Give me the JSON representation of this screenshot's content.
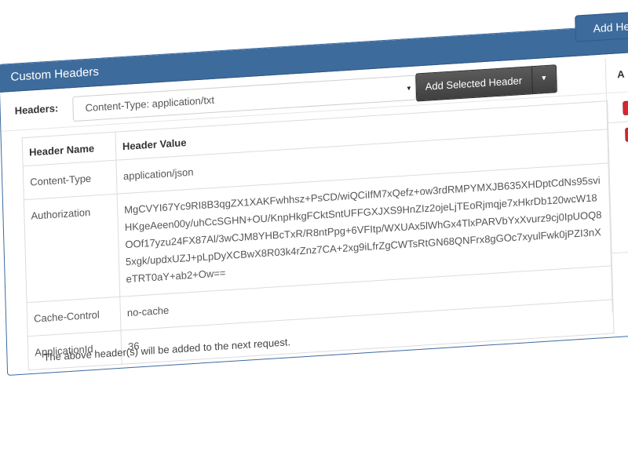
{
  "panel": {
    "title": "Custom Headers",
    "add_header_button": "Add Header"
  },
  "selector": {
    "label": "Headers:",
    "selected_value": "Content-Type: application/txt",
    "add_selected_button": "Add Selected Header"
  },
  "table": {
    "columns": [
      "Header Name",
      "Header Value"
    ],
    "actions_column_label": "A",
    "rows": [
      {
        "name": "Content-Type",
        "value": "application/json"
      },
      {
        "name": "Authorization",
        "value": "MgCVYI67Yc9RI8B3qgZX1XAKFwhhsz+PsCD/wiQCiIfM7xQefz+ow3rdRMPYMXJB635XHDptCdNs95sviHKgeAeen00y/uhCcSGHN+OU/KnpHkgFCktSntUFFGXJXS9HnZIz2ojeLjTEoRjmqje7xHkrDb120wcW18OOf17yzu24FX87Al/3wCJM8YHBcTxR/R8ntPpg+6VFItp/WXUAx5lWhGx4TlxPARVbYxXvurz9cj0IpUOQ85xgk/updxUZJ+pLpDyXCBwX8R03k4rZnz7CA+2xg9iLfrZgCWTsRtGN68QNFrx8gGOc7xyulFwk0jPZI3nXeTRT0aY+ab2+Ow=="
      },
      {
        "name": "Cache-Control",
        "value": "no-cache"
      },
      {
        "name": "ApplicationId",
        "value": "36"
      }
    ]
  },
  "footer_note": "The above header(s) will be added to the next request.",
  "colors": {
    "panel_header_bg": "#3d6b9c",
    "add_selected_bg": "#4a4a4a",
    "delete_button": "#d9262d"
  },
  "icons": {
    "select_arrow": "caret-down-icon",
    "dropdown_caret": "caret-down-icon",
    "delete": "remove-icon"
  }
}
